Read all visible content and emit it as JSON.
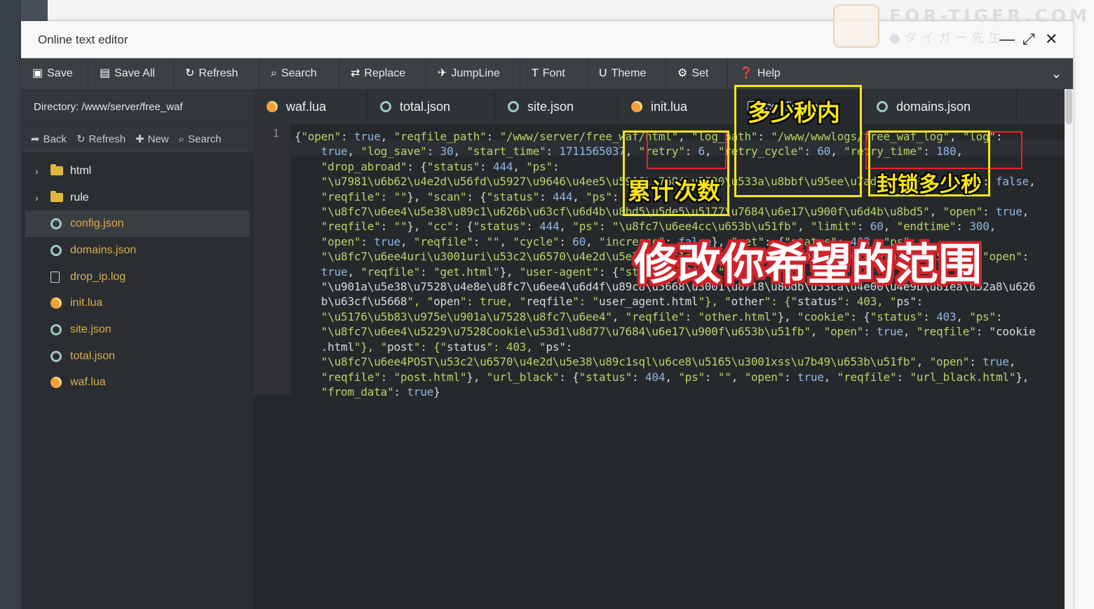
{
  "window": {
    "title": "Online text editor",
    "minimize_glyph": "—",
    "maximize_glyph": "⤢",
    "close_glyph": "✕"
  },
  "toolbar": {
    "save": "Save",
    "save_all": "Save All",
    "refresh": "Refresh",
    "search": "Search",
    "replace": "Replace",
    "jumpline": "JumpLine",
    "font": "Font",
    "theme": "Theme",
    "set": "Set",
    "help": "Help",
    "expand_icon": "chevron-down-icon"
  },
  "sidebar": {
    "directory": "Directory: /www/server/free_waf",
    "back": "Back",
    "refresh": "Refresh",
    "new": "New",
    "search": "Search",
    "items": [
      {
        "label": "html",
        "type": "folder"
      },
      {
        "label": "rule",
        "type": "folder"
      },
      {
        "label": "config.json",
        "type": "json"
      },
      {
        "label": "domains.json",
        "type": "json"
      },
      {
        "label": "drop_ip.log",
        "type": "log"
      },
      {
        "label": "init.lua",
        "type": "lua"
      },
      {
        "label": "site.json",
        "type": "json"
      },
      {
        "label": "total.json",
        "type": "json"
      },
      {
        "label": "waf.lua",
        "type": "lua"
      }
    ]
  },
  "tabs": [
    {
      "label": "waf.lua",
      "type": "lua"
    },
    {
      "label": "total.json",
      "type": "json"
    },
    {
      "label": "site.json",
      "type": "json"
    },
    {
      "label": "init.lua",
      "type": "lua"
    },
    {
      "label": "config.json",
      "type": "file"
    },
    {
      "label": "domains.json",
      "type": "json"
    }
  ],
  "editor": {
    "line_number": "1",
    "lines": [
      "{\"open\": true, \"reqfile_path\": \"/www/server/free_waf/html\", \"log_path\": \"/www/wwwlogs/free_waf_log\", \"log\":",
      "    true, \"log_save\": 30, \"start_time\": 1711565037, \"retry\": 6, \"retry_cycle\": 60, \"retry_time\": 180,",
      "    \"drop_abroad\": {\"status\": 444, \"ps\":",
      "    \"\\u7981\\u6b62\\u4e2d\\u56fd\\u5927\\u9646\\u4ee5\\u5916\\u7684\\u5730\\u533a\\u8bbf\\u95ee\\u7ad9\\u70b9\", \"open\": false,",
      "    \"reqfile\": \"\"}, \"scan\": {\"status\": 444, \"ps\":",
      "    \"\\u8fc7\\u6ee4\\u5e38\\u89c1\\u626b\\u63cf\\u6d4b\\u8bd5\\u5de5\\u5177\\u7684\\u6e17\\u900f\\u6d4b\\u8bd5\", \"open\": true,",
      "    \"reqfile\": \"\"}, \"cc\": {\"status\": 444, \"ps\": \"\\u8fc7\\u6ee4cc\\u653b\\u51fb\", \"limit\": 60, \"endtime\": 300,",
      "    \"open\": true, \"reqfile\": \"\", \"cycle\": 60, \"increase\": false}, \"get\": {\"status\": 403, \"ps\":",
      "    \"\\u8fc7\\u6ee4uri\\u3001uri\\u53c2\\u6570\\u4e2d\\u5e38\\u89c1sql\\u6ce8\\u5165\\u3001xss\\u7b49\\u653b\\u51fb\", \"open\":",
      "    true, \"reqfile\": \"get.html\"}, \"user-agent\": {\"status\": 403, \"ps\":",
      "    \"\\u901a\\u5e38\\u7528\\u4e8e\\u8fc7\\u6ee4\\u6d4f\\u89c8\\u5668\\u3001\\u8718\\u86db\\u53ca\\u4e00\\u4e9b\\u81ea\\u52a8\\u626",
      "    b\\u63cf\\u5668\", \"open\": true, \"reqfile\": \"user_agent.html\"}, \"other\": {\"status\": 403, \"ps\":",
      "    \"\\u5176\\u5b83\\u975e\\u901a\\u7528\\u8fc7\\u6ee4\", \"reqfile\": \"other.html\"}, \"cookie\": {\"status\": 403, \"ps\":",
      "    \"\\u8fc7\\u6ee4\\u5229\\u7528Cookie\\u53d1\\u8d77\\u7684\\u6e17\\u900f\\u653b\\u51fb\", \"open\": true, \"reqfile\": \"cookie",
      "    .html\"}, \"post\": {\"status\": 403, \"ps\":",
      "    \"\\u8fc7\\u6ee4POST\\u53c2\\u6570\\u4e2d\\u5e38\\u89c1sql\\u6ce8\\u5165\\u3001xss\\u7b49\\u653b\\u51fb\", \"open\": true,",
      "    \"reqfile\": \"post.html\"}, \"url_black\": {\"status\": 404, \"ps\": \"\", \"open\": true, \"reqfile\": \"url_black.html\"},",
      "    \"from_data\": true}"
    ]
  },
  "annotations": {
    "retry_label": "累计次数",
    "retry_cycle_label": "多少秒内",
    "retry_time_label": "封锁多少秒",
    "main_caption": "修改你希望的范围",
    "highlight_color": "#f5e41a",
    "red_color": "#e4262a"
  },
  "watermark": {
    "main": "FOR-TIGER.COM",
    "sub": "●タイガー先生"
  },
  "colors": {
    "toolbar_bg": "#3c4045",
    "sidebar_bg": "#2a2d31",
    "editor_bg": "#26292c",
    "file_label": "#d8b04a",
    "string": "#b5d36a",
    "value": "#8eb6e6"
  }
}
